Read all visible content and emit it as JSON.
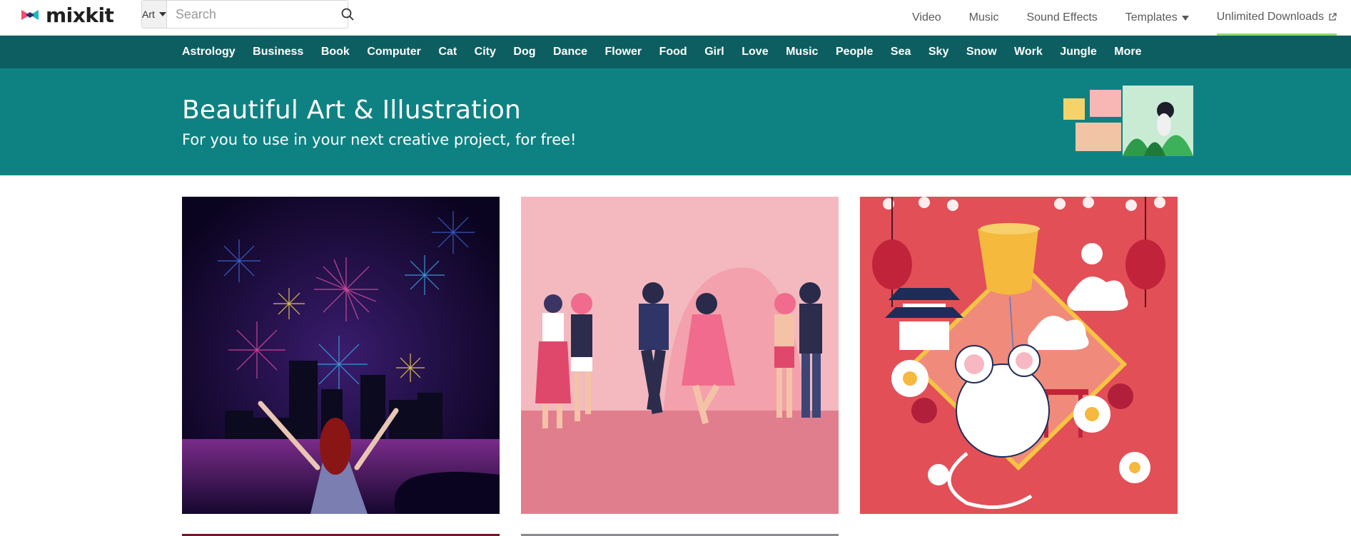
{
  "brand": {
    "name": "mixkit"
  },
  "search": {
    "category": "Art",
    "placeholder": "Search"
  },
  "topnav": [
    {
      "label": "Video"
    },
    {
      "label": "Music"
    },
    {
      "label": "Sound Effects"
    },
    {
      "label": "Templates"
    },
    {
      "label": "Unlimited Downloads"
    }
  ],
  "categories": [
    "Astrology",
    "Business",
    "Book",
    "Computer",
    "Cat",
    "City",
    "Dog",
    "Dance",
    "Flower",
    "Food",
    "Girl",
    "Love",
    "Music",
    "People",
    "Sea",
    "Sky",
    "Snow",
    "Work",
    "Jungle",
    "More"
  ],
  "hero": {
    "title": "Beautiful Art & Illustration",
    "subtitle": "For you to use in your next creative project, for free!"
  },
  "colors": {
    "catbar": "#0d5e60",
    "hero": "#0e8283",
    "accent": "#8dd96e"
  },
  "icons": {
    "search": "search-icon",
    "external": "external-link-icon",
    "dropdown": "chevron-down-icon"
  }
}
